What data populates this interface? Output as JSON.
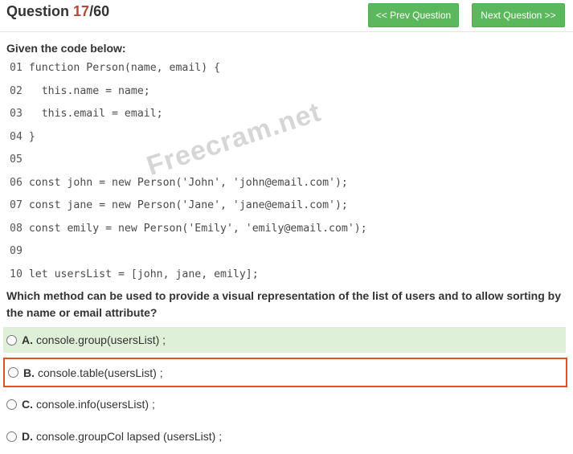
{
  "header": {
    "question_label": "Question",
    "current": "17",
    "total": "/60",
    "prev_label": "<< Prev Question",
    "next_label": "Next Question >>"
  },
  "given_label": "Given the code below:",
  "code_lines": [
    {
      "n": "01",
      "code": "function Person(name, email) {"
    },
    {
      "n": "02",
      "code": "  this.name = name;"
    },
    {
      "n": "03",
      "code": "  this.email = email;"
    },
    {
      "n": "04",
      "code": "}"
    },
    {
      "n": "05",
      "code": ""
    },
    {
      "n": "06",
      "code": "const john = new Person('John', 'john@email.com');"
    },
    {
      "n": "07",
      "code": "const jane = new Person('Jane', 'jane@email.com');"
    },
    {
      "n": "08",
      "code": "const emily = new Person('Emily', 'emily@email.com');"
    },
    {
      "n": "09",
      "code": ""
    },
    {
      "n": "10",
      "code": "let usersList = [john, jane, emily];"
    }
  ],
  "watermark": "Freecram.net",
  "question_text": "Which method can be used to provide a visual representation of the list of users and to allow sorting by the name or email attribute?",
  "options": [
    {
      "letter": "A.",
      "text": "console.group(usersList) ;"
    },
    {
      "letter": "B.",
      "text": "console.table(usersList) ;"
    },
    {
      "letter": "C.",
      "text": "console.info(usersList) ;"
    },
    {
      "letter": "D.",
      "text": "console.groupCol lapsed (usersList) ;"
    }
  ],
  "colors": {
    "button_green": "#5cb85c",
    "correct_bg": "#dff0d8",
    "selected_border": "#e0531f",
    "question_number": "#b04a3f"
  }
}
